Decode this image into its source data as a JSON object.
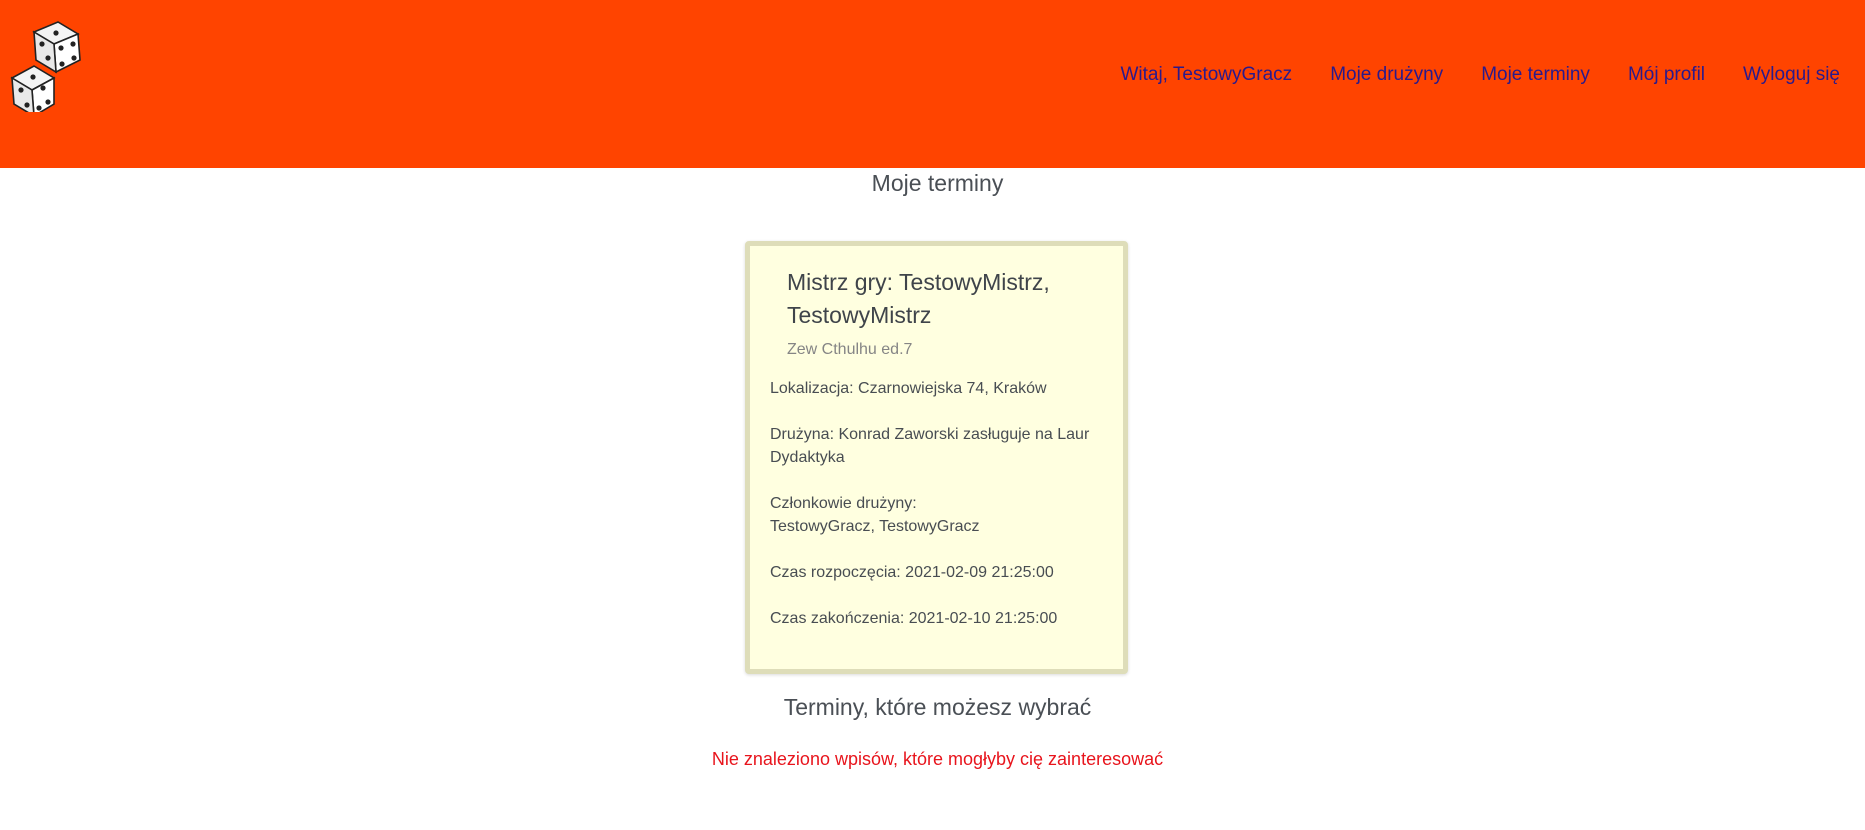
{
  "header": {
    "logo_icon": "dice-icon",
    "nav": [
      {
        "label": "Witaj, TestowyGracz"
      },
      {
        "label": "Moje drużyny"
      },
      {
        "label": "Moje terminy"
      },
      {
        "label": "Mój profil"
      },
      {
        "label": "Wyloguj się"
      }
    ]
  },
  "page_title": "Moje terminy",
  "card": {
    "title": "Mistrz gry: TestowyMistrz, TestowyMistrz",
    "subtitle": "Zew Cthulhu ed.7",
    "location": "Lokalizacja: Czarnowiejska 74, Kraków",
    "team": "Drużyna: Konrad Zaworski zasługuje na Laur Dydaktyka",
    "members_label": "Członkowie drużyny:",
    "members": "TestowyGracz, TestowyGracz",
    "start": "Czas rozpoczęcia: 2021-02-09 21:25:00",
    "end": "Czas zakończenia: 2021-02-10 21:25:00"
  },
  "available_title": "Terminy, które możesz wybrać",
  "empty_message": "Nie znaleziono wpisów, które mogłyby cię zainteresować",
  "colors": {
    "header_bg": "#ff4400",
    "nav_link": "#2a1a8c",
    "card_bg": "#ffffe0",
    "card_border": "#deddb9",
    "error_text": "#e8141c"
  }
}
